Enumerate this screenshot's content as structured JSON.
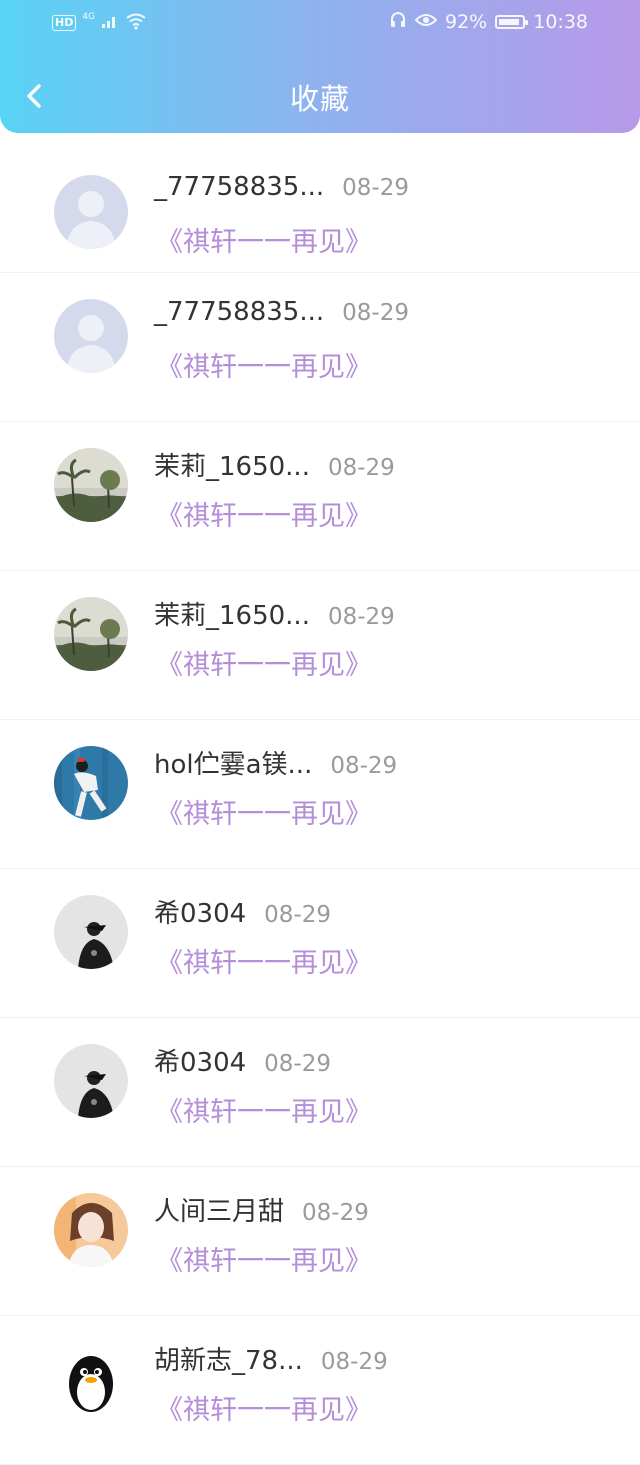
{
  "status_bar": {
    "left_badge": "HD",
    "network": "4G",
    "battery_percent": "92%",
    "battery_level": 0.92,
    "time": "10:38"
  },
  "header": {
    "title": "收藏",
    "back_icon": "chevron-left-icon"
  },
  "colors": {
    "header_gradient_start": "#58d3f4",
    "header_gradient_end": "#b799e8",
    "song_accent": "#b48ed8"
  },
  "favorites": [
    {
      "name": "_77758835...",
      "date": "08-29",
      "song": "《祺轩一一再见》",
      "avatar": "default-user-avatar"
    },
    {
      "name": "_77758835...",
      "date": "08-29",
      "song": "《祺轩一一再见》",
      "avatar": "default-user-avatar"
    },
    {
      "name": "茉莉_1650...",
      "date": "08-29",
      "song": "《祺轩一一再见》",
      "avatar": "landscape-avatar"
    },
    {
      "name": "茉莉_1650...",
      "date": "08-29",
      "song": "《祺轩一一再见》",
      "avatar": "landscape-avatar"
    },
    {
      "name": "hol伫霎a镁...",
      "date": "08-29",
      "song": "《祺轩一一再见》",
      "avatar": "person-blue-wall-avatar"
    },
    {
      "name": "希0304",
      "date": "08-29",
      "song": "《祺轩一一再见》",
      "avatar": "bw-person-avatar"
    },
    {
      "name": "希0304",
      "date": "08-29",
      "song": "《祺轩一一再见》",
      "avatar": "bw-person-avatar"
    },
    {
      "name": "人间三月甜",
      "date": "08-29",
      "song": "《祺轩一一再见》",
      "avatar": "girl-portrait-avatar"
    },
    {
      "name": "胡新志_78...",
      "date": "08-29",
      "song": "《祺轩一一再见》",
      "avatar": "penguin-avatar"
    }
  ]
}
